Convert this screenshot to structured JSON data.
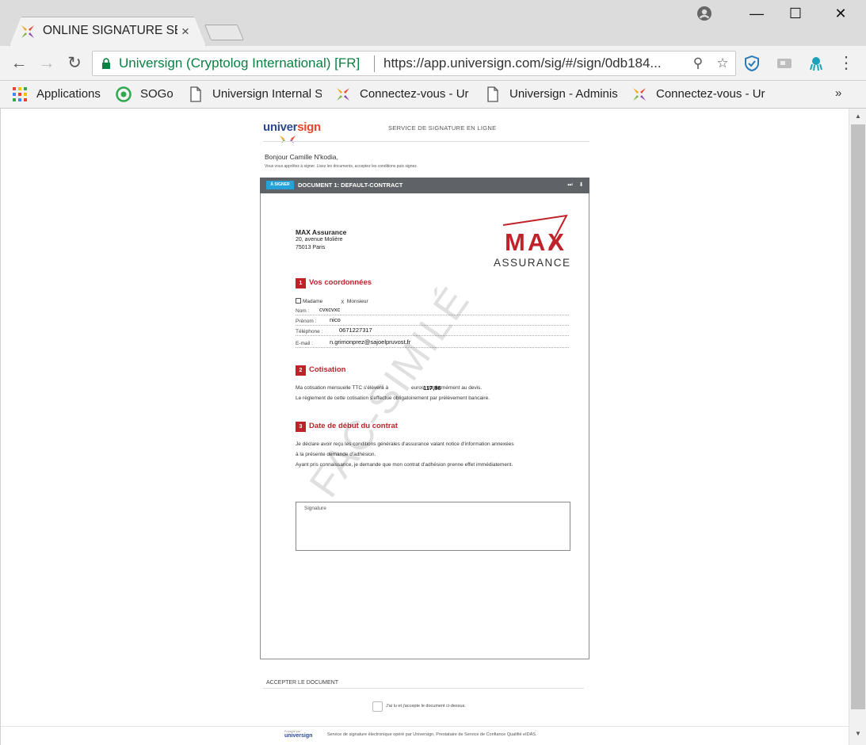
{
  "browser": {
    "tab_title": "ONLINE SIGNATURE SERV",
    "tab_close": "×",
    "site_name": "Universign (Cryptolog International) [FR]",
    "url": "https://app.universign.com/sig/#/sign/0db184...",
    "nav_back": "←",
    "nav_forward": "→",
    "nav_reload": "↻",
    "zoom_icon": "⚲",
    "star_icon": "☆",
    "menu_icon": "⋮",
    "minimize": "—",
    "maximize": "☐",
    "close": "✕",
    "bookmarks": [
      {
        "label": "Applications",
        "icon": "apps-grid-icon"
      },
      {
        "label": "SOGo",
        "icon": "sogo-icon"
      },
      {
        "label": "Universign Internal S",
        "icon": "page-icon"
      },
      {
        "label": "Connectez-vous - Ur",
        "icon": "universign-star-icon"
      },
      {
        "label": "Universign - Adminis",
        "icon": "page-icon"
      },
      {
        "label": "Connectez-vous - Ur",
        "icon": "universign-star-icon"
      }
    ],
    "bookmarks_more": "»"
  },
  "page": {
    "logo_text_a": "univer",
    "logo_text_b": "sign",
    "service_title": "SERVICE DE SIGNATURE EN LIGNE",
    "greeting": "Bonjour Camille N'kodia,",
    "instructions": "Vous vous apprêtez à signer. Lisez les documents, acceptez les conditions puis signez.",
    "doc_badge": "À SIGNER",
    "doc_title": "DOCUMENT 1: DEFAULT-CONTRACT",
    "doc_skip_icon": "⏭",
    "doc_download_icon": "⬇",
    "accept_title": "ACCEPTER LE DOCUMENT",
    "accept_label": "J'ai lu et j'accepte le document ci-dessus.",
    "footer_logo_small": "Propulsé par",
    "footer_logo": "universign",
    "footer_text": "Service de signature électronique opéré par Universign, Prestataire de Service de Confiance Qualifié eIDAS."
  },
  "contract": {
    "company": "MAX Assurance",
    "address1": "20, avenue Molière",
    "address2": "75013 Paris",
    "logo_max": "MAX",
    "logo_assurance": "ASSURANCE",
    "section1_num": "1",
    "section1_title": "Vos coordonnées",
    "madame_label": "Madame",
    "monsieur_label": "Monsieur",
    "monsieur_checked": "X",
    "nom_label": "Nom :",
    "nom_value": "cvxcvxc",
    "prenom_label": "Prénom :",
    "prenom_value": "nico",
    "telephone_label": "Téléphone :",
    "telephone_value": "0671227317",
    "email_label": "E-mail :",
    "email_value": "n.grimonprez@sajoelpruvost.fr",
    "section2_num": "2",
    "section2_title": "Cotisation",
    "cotisation_text1": "Ma cotisation mensuelle TTC s'élèvera à                euros, conformément au devis.",
    "cotisation_value": "117,86",
    "cotisation_text2": "Le règlement de cette cotisation s'effectue obligatoirement par prélèvement bancaire.",
    "section3_num": "3",
    "section3_title": "Date de début du contrat",
    "date_text1": "Je déclare avoir reçu les conditions générales d'assurance valant notice d'information annexées",
    "date_text2": "à la présente demande d'adhésion.",
    "date_text3": "Ayant pris connaissance, je demande que mon contrat d'adhésion prenne effet immédiatement.",
    "signature_label": "Signature",
    "watermark": "FAC-SIMILÉ"
  }
}
